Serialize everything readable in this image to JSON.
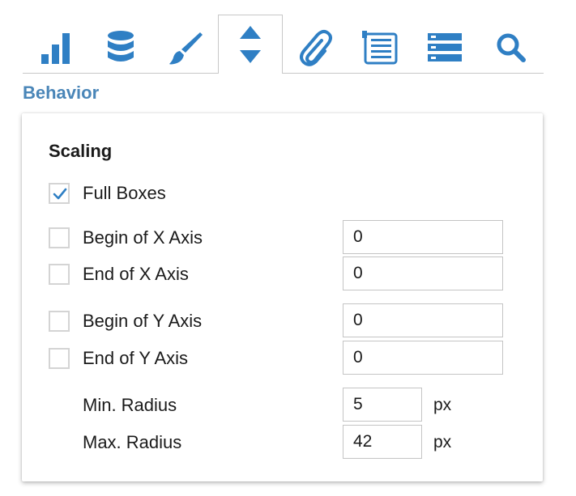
{
  "toolbar": {
    "tabs": [
      {
        "icon": "bar-chart-icon",
        "active": false
      },
      {
        "icon": "database-icon",
        "active": false
      },
      {
        "icon": "brush-icon",
        "active": false
      },
      {
        "icon": "up-down-arrows-icon",
        "active": true
      },
      {
        "icon": "paperclip-icon",
        "active": false
      },
      {
        "icon": "numbered-list-icon",
        "active": false
      },
      {
        "icon": "server-stack-icon",
        "active": false
      },
      {
        "icon": "search-icon",
        "active": false
      }
    ],
    "icon_color": "#2f7fc4"
  },
  "section_title": "Behavior",
  "panel": {
    "title": "Scaling",
    "full_boxes": {
      "label": "Full Boxes",
      "checked": true
    },
    "begin_x": {
      "label": "Begin of X Axis",
      "checked": false,
      "value": "0"
    },
    "end_x": {
      "label": "End of X Axis",
      "checked": false,
      "value": "0"
    },
    "begin_y": {
      "label": "Begin of Y Axis",
      "checked": false,
      "value": "0"
    },
    "end_y": {
      "label": "End of Y Axis",
      "checked": false,
      "value": "0"
    },
    "min_radius": {
      "label": "Min. Radius",
      "value": "5",
      "unit": "px"
    },
    "max_radius": {
      "label": "Max. Radius",
      "value": "42",
      "unit": "px"
    }
  }
}
